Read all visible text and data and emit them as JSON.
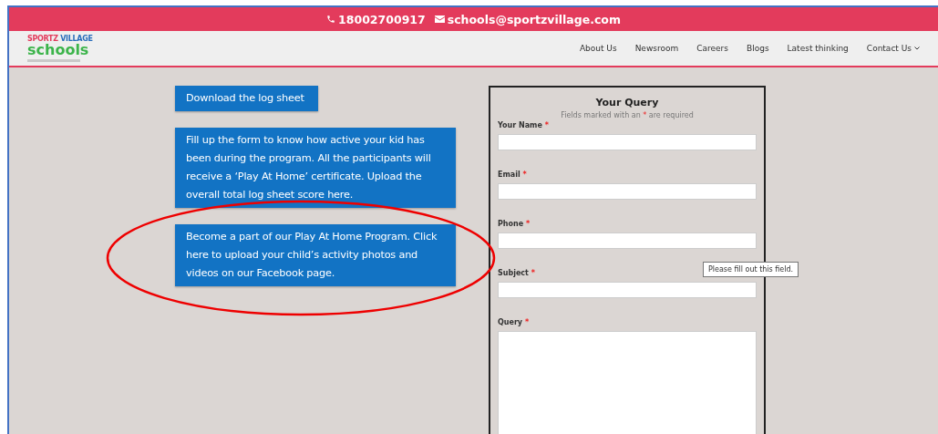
{
  "top_bar": {
    "phone": "18002700917",
    "email": "schools@sportzvillage.com"
  },
  "logo": {
    "brand_first": "SPORTZ",
    "brand_second": "VILLAGE",
    "name": "schools"
  },
  "nav": [
    {
      "label": "About Us",
      "dropdown": false
    },
    {
      "label": "Newsroom",
      "dropdown": false
    },
    {
      "label": "Careers",
      "dropdown": false
    },
    {
      "label": "Blogs",
      "dropdown": false
    },
    {
      "label": "Latest thinking",
      "dropdown": false
    },
    {
      "label": "Contact Us",
      "dropdown": true
    }
  ],
  "info_buttons": [
    "Download the log sheet",
    "Fill up the form to know how active your kid has been during the program. All the participants will receive a ‘Play At Home’ certificate. Upload the overall total log sheet score here.",
    "Become a part of our Play At Home Program. Click here to upload your child’s activity photos and videos on our Facebook page."
  ],
  "form": {
    "title": "Your Query",
    "note": {
      "before": "Fields marked with an",
      "mark": "*",
      "after": "are required"
    },
    "fields": [
      {
        "label": "Your Name",
        "required_mark": "*",
        "kind": "text"
      },
      {
        "label": "Email",
        "required_mark": "*",
        "kind": "text"
      },
      {
        "label": "Phone",
        "required_mark": "*",
        "kind": "text"
      },
      {
        "label": "Subject",
        "required_mark": "*",
        "kind": "text"
      },
      {
        "label": "Query",
        "required_mark": "*",
        "kind": "textarea"
      }
    ],
    "tooltip": "Please fill out this field."
  }
}
